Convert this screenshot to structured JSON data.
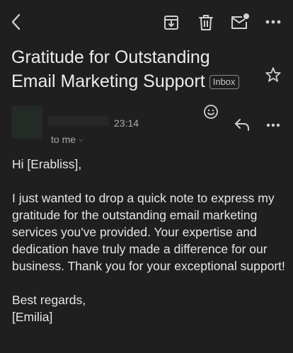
{
  "toolbar": {
    "back_icon": "back-arrow-icon",
    "archive_icon": "archive-icon",
    "delete_icon": "trash-icon",
    "mark_unread_icon": "mail-unread-icon",
    "more_icon": "more-horizontal-icon"
  },
  "message": {
    "subject": "Gratitude for Outstanding Email Marketing Support",
    "label": "Inbox",
    "time": "23:14",
    "recipient": "to me",
    "body": {
      "greeting": "Hi [Erabliss],",
      "paragraph": "I just wanted to drop a quick note to express my gratitude for the outstanding email marketing services you've provided. Your expertise and dedication have truly made a difference for our business. Thank you for your exceptional support!",
      "closing": "Best regards,",
      "signature": "[Emilia]"
    }
  },
  "colors": {
    "background": "#1f1f1f",
    "text": "#e3e3e3",
    "muted": "#aaaaaa"
  }
}
